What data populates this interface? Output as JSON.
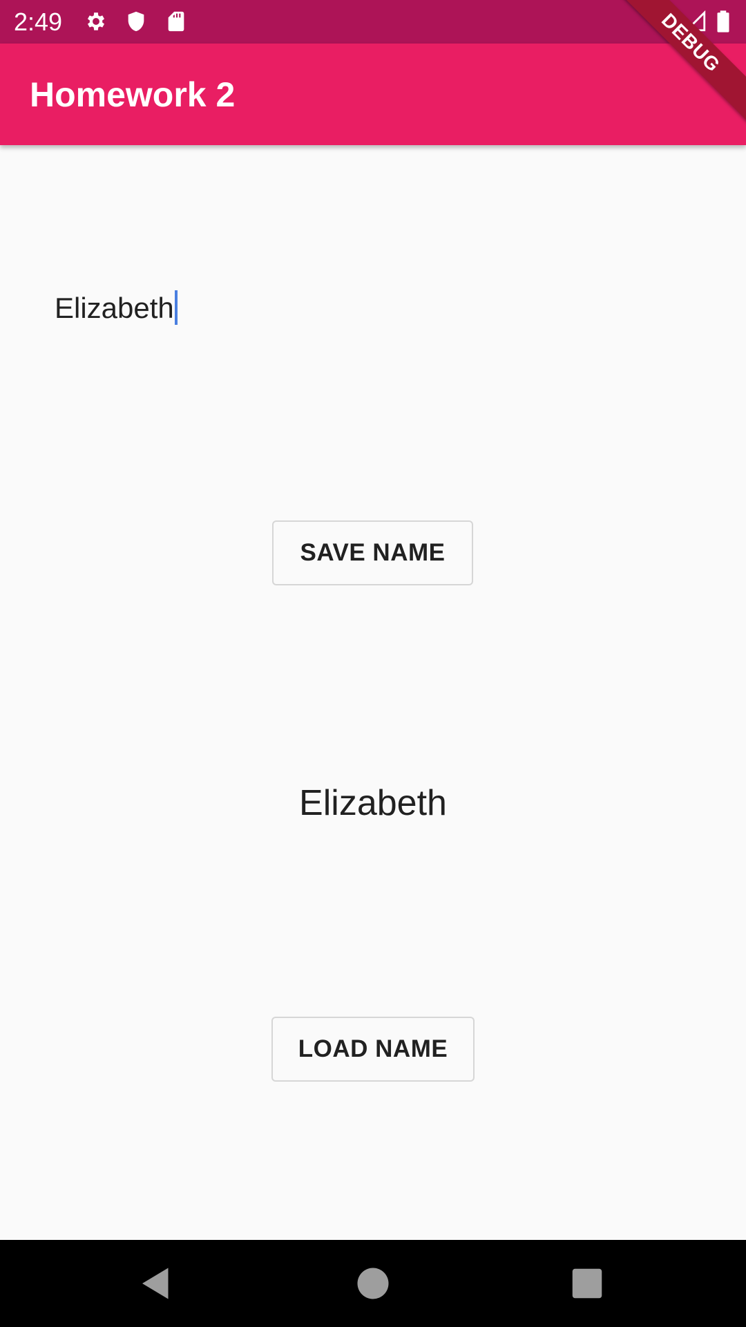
{
  "status_bar": {
    "time": "2:49",
    "icons": [
      "gear-icon",
      "shield-icon",
      "sd-card-icon",
      "wifi-icon",
      "signal-icon",
      "battery-icon"
    ],
    "color": "#ad1457"
  },
  "app_bar": {
    "title": "Homework 2",
    "color": "#e91e63"
  },
  "debug_banner": {
    "label": "DEBUG"
  },
  "name_field": {
    "value": "Elizabeth",
    "placeholder": ""
  },
  "buttons": {
    "save_label": "SAVE NAME",
    "load_label": "LOAD NAME"
  },
  "display": {
    "name": "Elizabeth"
  },
  "nav_bar": {
    "icons": [
      "back-icon",
      "home-icon",
      "recents-icon"
    ]
  }
}
